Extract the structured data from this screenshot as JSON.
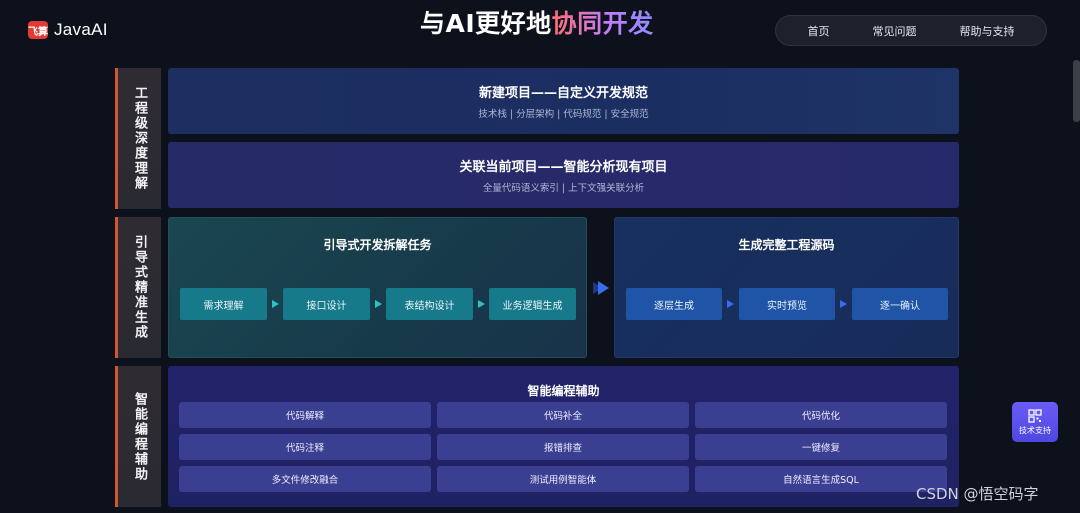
{
  "header": {
    "logo_badge": "飞算",
    "logo_text": "JavaAI",
    "title_plain": "与AI更好地",
    "title_highlight": "协同开发",
    "nav": [
      "首页",
      "常见问题",
      "帮助与支持"
    ]
  },
  "section1": {
    "side_label": "工程级深度理解",
    "cards": [
      {
        "title": "新建项目——自定义开发规范",
        "subtitle": "技术栈 | 分层架构 | 代码规范 | 安全规范"
      },
      {
        "title": "关联当前项目——智能分析现有项目",
        "subtitle": "全量代码语义索引 | 上下文强关联分析"
      }
    ]
  },
  "section2": {
    "side_label": "引导式精准生成",
    "left_title": "引导式开发拆解任务",
    "left_steps": [
      "需求理解",
      "接口设计",
      "表结构设计",
      "业务逻辑生成"
    ],
    "right_title": "生成完整工程源码",
    "right_steps": [
      "逐层生成",
      "实时预览",
      "逐一确认"
    ]
  },
  "section3": {
    "side_label": "智能编程辅助",
    "title": "智能编程辅助",
    "items": [
      "代码解释",
      "代码补全",
      "代码优化",
      "代码注释",
      "报错排查",
      "一键修复",
      "多文件修改融合",
      "测试用例智能体",
      "自然语言生成SQL"
    ]
  },
  "floating": {
    "support_label": "技术支持"
  },
  "watermark": "CSDN @悟空码字",
  "colors": {
    "accent_orange": "#d2562e",
    "teal_step": "#167a8a",
    "blue_step": "#1f54a7",
    "chip": "#3b3f92",
    "support": "#5b52ec"
  }
}
